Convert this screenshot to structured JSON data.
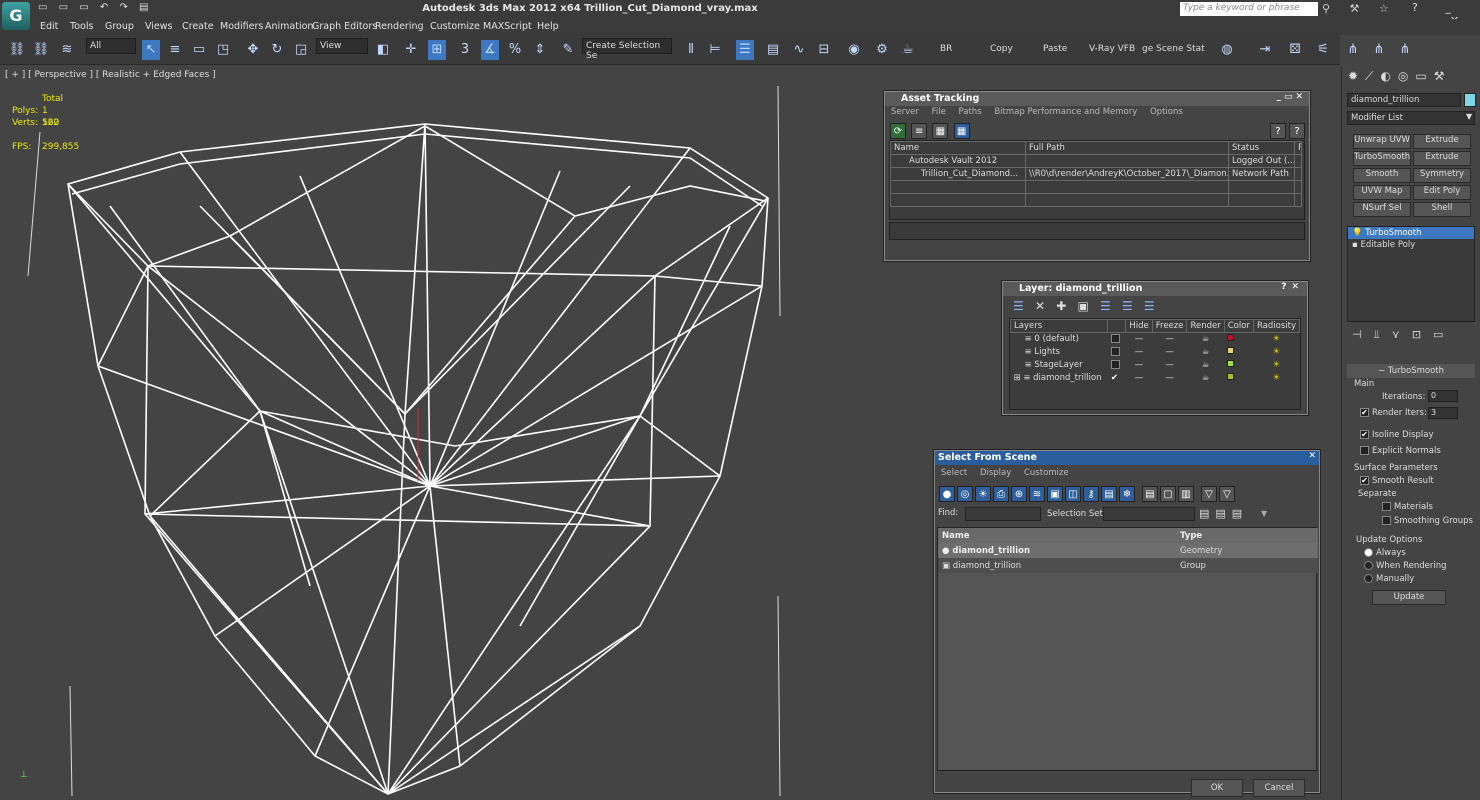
{
  "app": {
    "title": "Autodesk 3ds Max  2012 x64     Trillion_Cut_Diamond_vray.max",
    "search_placeholder": "Type a keyword or phrase"
  },
  "menu": [
    "Edit",
    "Tools",
    "Group",
    "Views",
    "Create",
    "Modifiers",
    "Animation",
    "Graph Editors",
    "Rendering",
    "Customize",
    "MAXScript",
    "Help"
  ],
  "toolbar": {
    "filter_select": "All",
    "ref_coord": "View",
    "named_selection": "Create Selection Se",
    "br_label": "BR",
    "copy_label": "Copy",
    "paste_label": "Paste",
    "vfb_label": "V-Ray VFB",
    "stage_label": "ge Scene Stat"
  },
  "viewport": {
    "label": "[ + ] [ Perspective ] [ Realistic + Edged Faces ]",
    "total_label": "Total",
    "polys_label": "Polys:",
    "polys_value": "1 120",
    "verts_label": "Verts:",
    "verts_value": "562",
    "fps_label": "FPS:",
    "fps_value": "299,855"
  },
  "asset_tracking": {
    "title": "Asset Tracking",
    "menu": [
      "Server",
      "File",
      "Paths",
      "Bitmap Performance and Memory",
      "Options"
    ],
    "columns": [
      "Name",
      "Full Path",
      "Status",
      "Pr"
    ],
    "rows": [
      {
        "name": "Autodesk Vault 2012",
        "path": "",
        "status": "Logged Out (..."
      },
      {
        "name": "Trillion_Cut_Diamond...",
        "path": "\\\\R0\\d\\render\\AndreyK\\October_2017\\_Diamon...",
        "status": "Network Path"
      }
    ]
  },
  "layer_dialog": {
    "title": "Layer: diamond_trillion",
    "columns": [
      "Layers",
      "",
      "Hide",
      "Freeze",
      "Render",
      "Color",
      "Radiosity"
    ],
    "rows": [
      {
        "name": "0 (default)",
        "current": false,
        "color": "#c0102a"
      },
      {
        "name": "Lights",
        "current": false,
        "color": "#e8d27a"
      },
      {
        "name": "StageLayer",
        "current": false,
        "color": "#9fe04a"
      },
      {
        "name": "diamond_trillion",
        "current": true,
        "color": "#a8c020"
      }
    ]
  },
  "select_from_scene": {
    "title": "Select From Scene",
    "menu": [
      "Select",
      "Display",
      "Customize"
    ],
    "find_label": "Find:",
    "selection_set_label": "Selection Set:",
    "columns": [
      "Name",
      "Type"
    ],
    "rows": [
      {
        "name": "diamond_trillion",
        "type": "Geometry"
      },
      {
        "name": "diamond_trillion",
        "type": "Group"
      }
    ],
    "ok_label": "OK",
    "cancel_label": "Cancel"
  },
  "command_panel": {
    "object_name": "diamond_trillion",
    "object_color": "#7fd6e6",
    "modifier_list": "Modifier List",
    "buttons": [
      "Unwrap UVW",
      "Extrude",
      "TurboSmooth",
      "Extrude",
      "Smooth",
      "Symmetry",
      "UVW Map",
      "Edit Poly",
      "NSurf Sel",
      "Shell"
    ],
    "stack": [
      "TurboSmooth",
      "Editable Poly"
    ],
    "rollout_title": "TurboSmooth",
    "main_label": "Main",
    "iterations_label": "Iterations:",
    "iterations_value": "0",
    "render_iters_label": "Render Iters:",
    "render_iters_value": "3",
    "isoline_label": "Isoline Display",
    "explicit_normals_label": "Explicit Normals",
    "surface_params_label": "Surface Parameters",
    "smooth_result_label": "Smooth Result",
    "separate_label": "Separate",
    "materials_label": "Materials",
    "smoothing_groups_label": "Smoothing Groups",
    "update_options_label": "Update Options",
    "always_label": "Always",
    "when_rendering_label": "When Rendering",
    "manually_label": "Manually",
    "update_button": "Update"
  }
}
